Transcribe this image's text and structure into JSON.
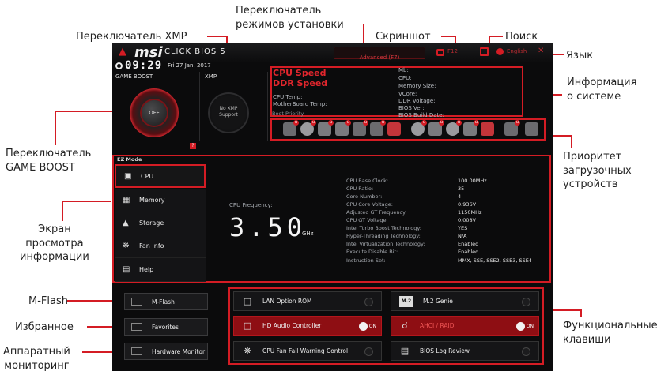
{
  "callouts": {
    "mode_switch": "Переключатель\nрежимов установки",
    "xmp_switch": "Переключатель XMP",
    "screenshot": "Скриншот",
    "search": "Поиск",
    "language": "Язык",
    "system_info": "Информация\nо системе",
    "game_boost_switch": "Переключатель\nGAME BOOST",
    "boot_priority": "Приоритет\nзагрузочных\nустройств",
    "info_screen": "Экран\nпросмотра\nинформации",
    "mflash": "M-Flash",
    "favorites": "Избранное",
    "hw_monitor": "Аппаратный\nмониторинг",
    "function_keys": "Функциональные\nклавиши"
  },
  "bios": {
    "brand": "msi",
    "product": "CLICK BIOS 5",
    "mode_tab": "Advanced (F7)",
    "f12_label": "F12",
    "language_label": "English",
    "close_glyph": "✕",
    "time": "09:29",
    "date": "Fri 27 Jan, 2017",
    "game_boost_label": "GAME BOOST",
    "xmp_label": "XMP",
    "knob_label": "OFF",
    "xmp_knob_label": "No XMP\nSupport",
    "cpu_speed": "CPU Speed",
    "ddr_speed": "DDR Speed",
    "cpu_temp": "CPU Temp:",
    "mb_temp": "MotherBoard Temp:",
    "sys_fields": [
      "Mb:",
      "CPU:",
      "Memory Size:",
      "VCore:",
      "DDR Voltage:",
      "BIOS Ver:",
      "BIOS Build Date:"
    ],
    "boot_priority_label": "Boot Priority",
    "ez_mode": "EZ Mode",
    "nav": [
      {
        "label": "CPU",
        "icon": "cpu-icon"
      },
      {
        "label": "Memory",
        "icon": "memory-icon"
      },
      {
        "label": "Storage",
        "icon": "storage-icon"
      },
      {
        "label": "Fan Info",
        "icon": "fan-icon"
      },
      {
        "label": "Help",
        "icon": "help-icon"
      }
    ],
    "cpu_freq_label": "CPU Frequency:",
    "cpu_freq_value": "3.50",
    "cpu_freq_unit": "GHz",
    "specs": [
      {
        "k": "CPU Base Clock:",
        "v": "100.00MHz"
      },
      {
        "k": "CPU Ratio:",
        "v": "35"
      },
      {
        "k": "Core Number:",
        "v": "4"
      },
      {
        "k": "CPU Core Voltage:",
        "v": "0.936V"
      },
      {
        "k": "Adjusted GT Frequency:",
        "v": "1150MHz"
      },
      {
        "k": "CPU GT Voltage:",
        "v": "0.008V"
      },
      {
        "k": "Intel Turbo Boost Technology:",
        "v": "YES"
      },
      {
        "k": "Hyper-Threading Technology:",
        "v": "N/A"
      },
      {
        "k": "Intel Virtualization Technology:",
        "v": "Enabled"
      },
      {
        "k": "Execute Disable Bit:",
        "v": "Enabled"
      },
      {
        "k": "Instruction Set:",
        "v": "MMX, SSE, SSE2, SSE3, SSE4"
      }
    ],
    "left_buttons": [
      "M-Flash",
      "Favorites",
      "Hardware Monitor"
    ],
    "fkeys": [
      {
        "label": "LAN Option ROM",
        "on": false,
        "icon": "lan-rom-icon"
      },
      {
        "label": "M.2 Genie",
        "on": false,
        "icon": "m2-icon"
      },
      {
        "label": "HD Audio Controller",
        "on": true,
        "icon": "audio-icon"
      },
      {
        "label": "AHCI / RAID",
        "on": true,
        "icon": "ahci-icon"
      },
      {
        "label": "CPU Fan Fail Warning Control",
        "on": false,
        "icon": "fan-warning-icon"
      },
      {
        "label": "BIOS Log Review",
        "on": false,
        "icon": "log-icon"
      }
    ],
    "on_label": "ON",
    "help_glyph": "?"
  },
  "colors": {
    "accent": "#d41c24",
    "bios_bg": "#0b0b0c"
  }
}
